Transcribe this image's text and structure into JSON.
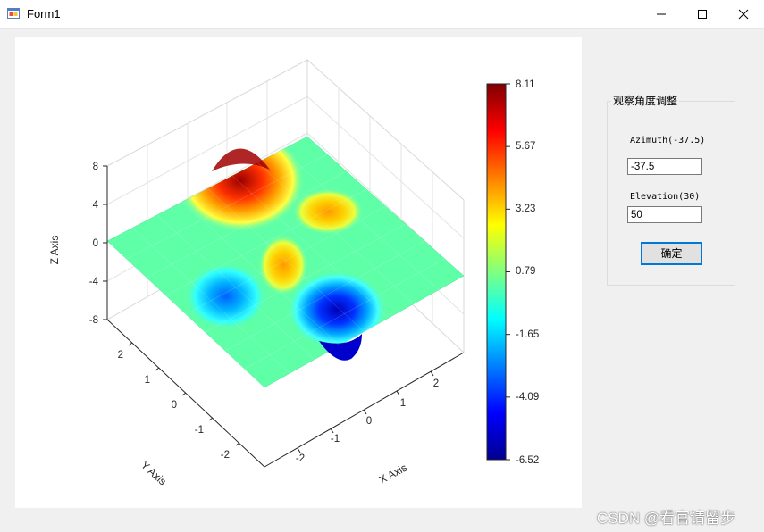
{
  "window": {
    "title": "Form1"
  },
  "chart_data": {
    "type": "surface",
    "xlabel": "X Axis",
    "ylabel": "Y Axis",
    "zlabel": "Z Axis",
    "x_ticks": [
      "-2",
      "-1",
      "0",
      "1",
      "2"
    ],
    "y_ticks": [
      "-2",
      "-1",
      "0",
      "1",
      "2"
    ],
    "z_ticks": [
      "8",
      "4",
      "0",
      "-4",
      "-8"
    ],
    "xlim": [
      -3,
      3
    ],
    "ylim": [
      -3,
      3
    ],
    "zlim": [
      -8,
      8
    ],
    "colorbar": {
      "ticks": [
        "8.11",
        "5.67",
        "3.23",
        "0.79",
        "-1.65",
        "-4.09",
        "-6.52"
      ],
      "min": -6.52,
      "max": 8.11,
      "colormap": "jet"
    },
    "view": {
      "azimuth": -37.5,
      "elevation": 30
    }
  },
  "panel": {
    "title": "观察角度调整",
    "azimuth_label": "Azimuth(-37.5)",
    "azimuth_value": "-37.5",
    "elevation_label": "Elevation(30)",
    "elevation_value": "50",
    "ok_label": "确定"
  },
  "watermark": "CSDN @看官请留步"
}
